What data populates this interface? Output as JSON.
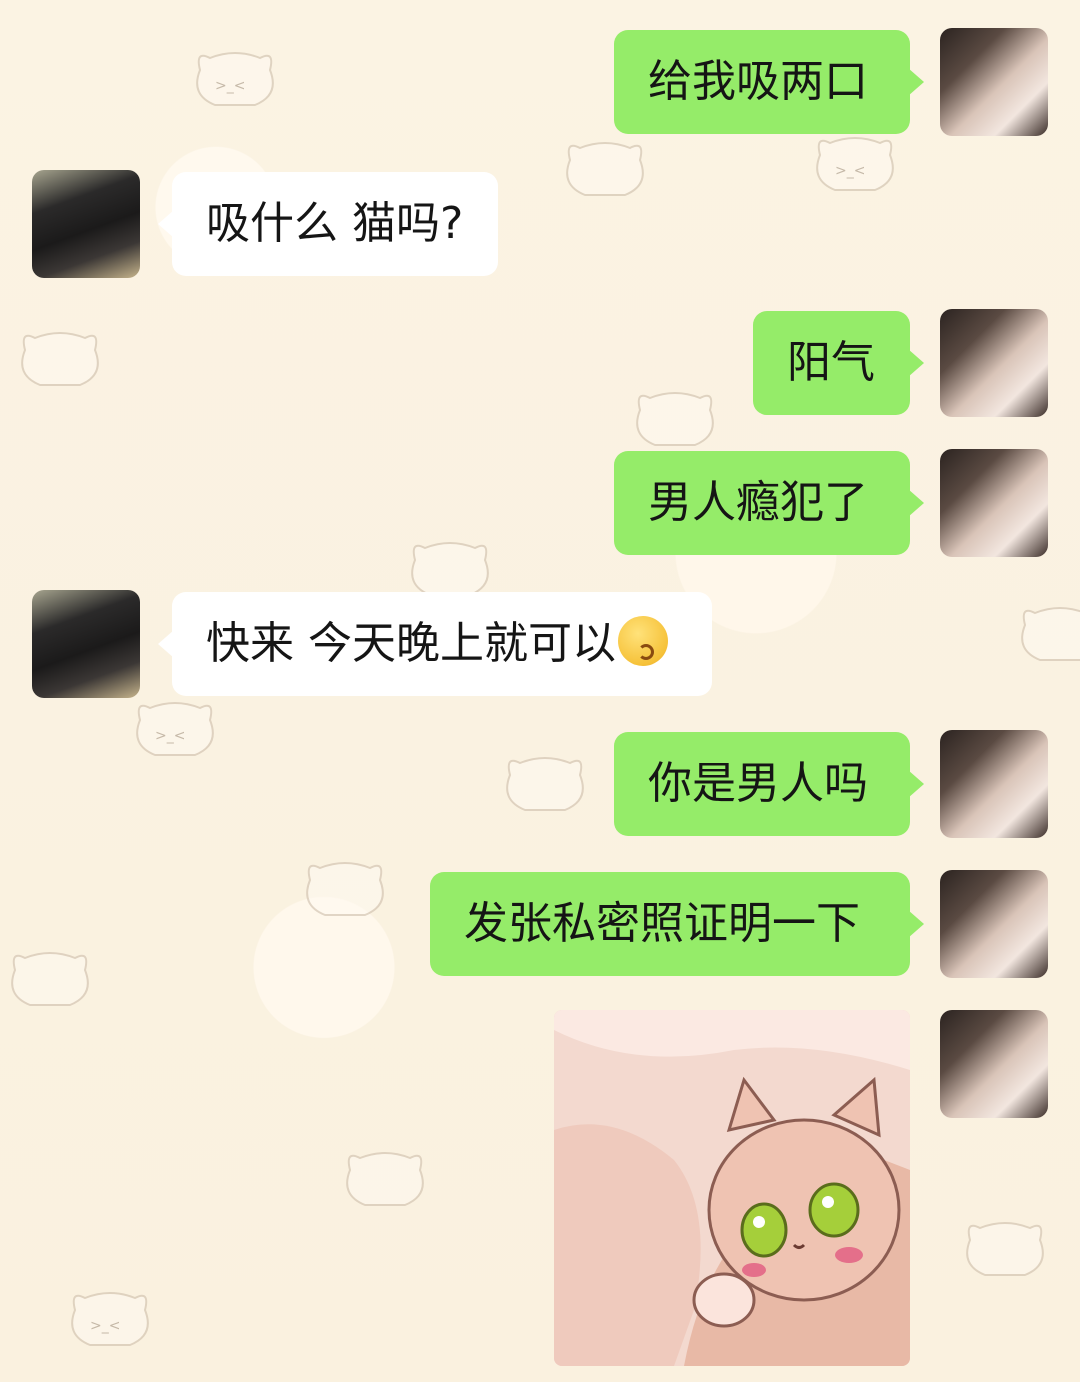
{
  "chat": {
    "messages": [
      {
        "side": "right",
        "text": "给我吸两口"
      },
      {
        "side": "left",
        "text": "吸什么 猫吗?"
      },
      {
        "side": "right",
        "text": "阳气"
      },
      {
        "side": "right",
        "text": "男人瘾犯了"
      },
      {
        "side": "left",
        "text": "快来 今天晚上就可以",
        "emoji": "kissing-face-emoji"
      },
      {
        "side": "right",
        "text": "你是男人吗"
      },
      {
        "side": "right",
        "text": "发张私密照证明一下"
      },
      {
        "side": "right",
        "sticker": "cat-hugging-sticker"
      }
    ]
  },
  "colors": {
    "sent_bubble": "#95ec69",
    "received_bubble": "#ffffff",
    "background": "#fbf4e6"
  }
}
